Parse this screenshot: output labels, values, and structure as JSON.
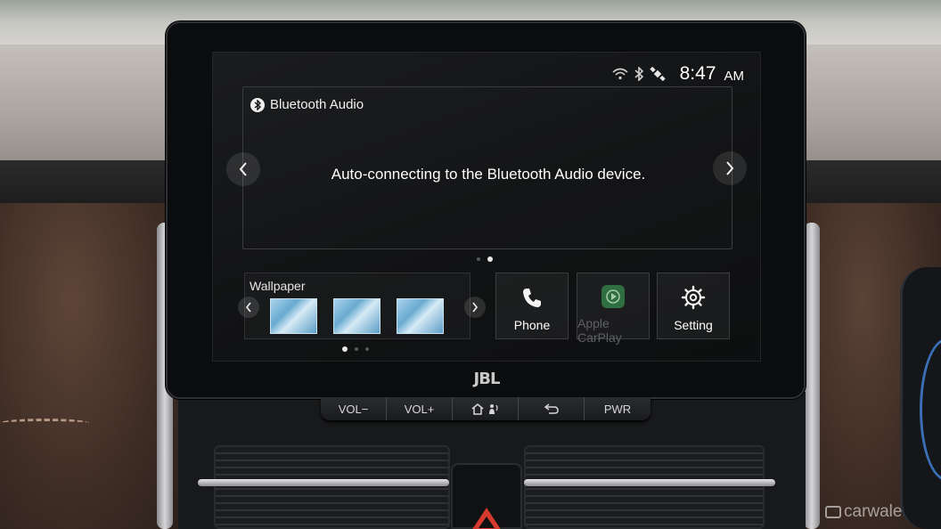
{
  "status_bar": {
    "time": "8:47",
    "ampm": "AM",
    "icons": [
      "wifi-icon",
      "bluetooth-icon",
      "satellite-icon"
    ]
  },
  "main_card": {
    "title": "Bluetooth Audio",
    "message": "Auto-connecting to the Bluetooth Audio device.",
    "page_count": 2,
    "active_page": 2
  },
  "wallpaper": {
    "title": "Wallpaper",
    "thumbnail_count": 3,
    "page_count": 3,
    "active_page": 1
  },
  "tiles": {
    "phone": {
      "label": "Phone",
      "icon": "phone-icon",
      "enabled": true
    },
    "carplay": {
      "label": "Apple CarPlay",
      "icon": "carplay-icon",
      "enabled": false
    },
    "setting": {
      "label": "Setting",
      "icon": "gear-icon",
      "enabled": true
    }
  },
  "hardware_buttons": {
    "vol_down": "VOL−",
    "vol_up": "VOL+",
    "home": "home-voice-icon",
    "back": "back-icon",
    "power": "PWR"
  },
  "brand": "JBL",
  "watermark": "carwale",
  "colors": {
    "carplay_green": "#3fb05a",
    "screen_bg": "#141517",
    "thumb_blue": "#6aaad1"
  }
}
